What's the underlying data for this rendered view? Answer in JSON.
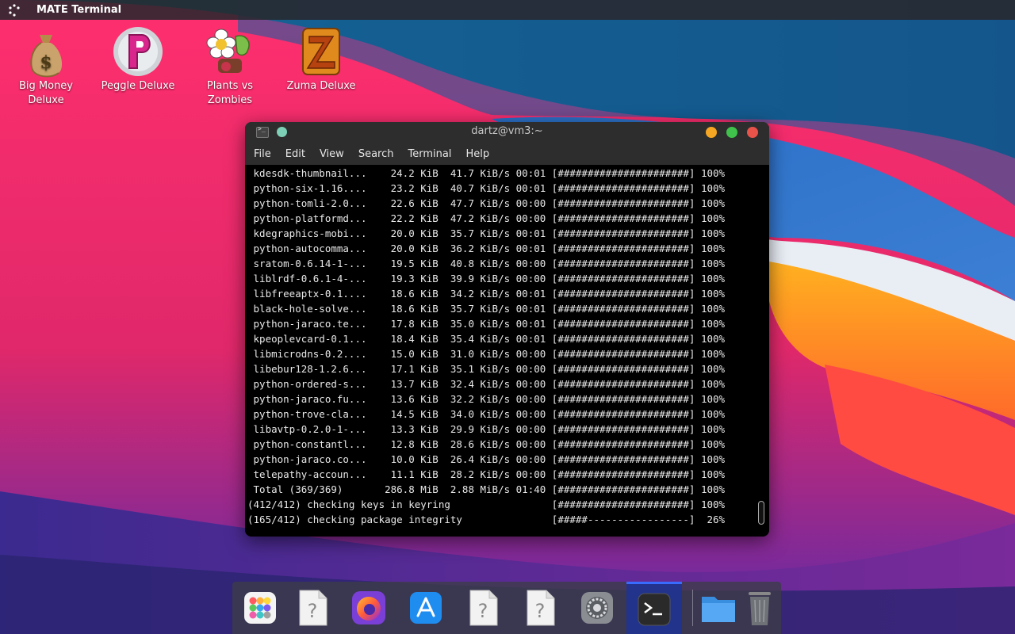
{
  "top_panel": {
    "title": "MATE Terminal",
    "icons": [
      "menu-dots-icon"
    ]
  },
  "desktop_icons": [
    {
      "label": "Big Money Deluxe",
      "icon": "money-bag-icon"
    },
    {
      "label": "Peggle Deluxe",
      "icon": "peggle-icon"
    },
    {
      "label": "Plants vs Zombies",
      "icon": "plants-vs-zombies-icon"
    },
    {
      "label": "Zuma Deluxe",
      "icon": "zuma-icon"
    }
  ],
  "terminal": {
    "title": "dartz@vm3:~",
    "menu": [
      "File",
      "Edit",
      "View",
      "Search",
      "Terminal",
      "Help"
    ],
    "lines": [
      " kdesdk-thumbnail...    24.2 KiB  41.7 KiB/s 00:01 [######################] 100%",
      " python-six-1.16....    23.2 KiB  40.7 KiB/s 00:01 [######################] 100%",
      " python-tomli-2.0...    22.6 KiB  47.7 KiB/s 00:00 [######################] 100%",
      " python-platformd...    22.2 KiB  47.2 KiB/s 00:00 [######################] 100%",
      " kdegraphics-mobi...    20.0 KiB  35.7 KiB/s 00:01 [######################] 100%",
      " python-autocomma...    20.0 KiB  36.2 KiB/s 00:01 [######################] 100%",
      " sratom-0.6.14-1-...    19.5 KiB  40.8 KiB/s 00:00 [######################] 100%",
      " liblrdf-0.6.1-4-...    19.3 KiB  39.9 KiB/s 00:00 [######################] 100%",
      " libfreeaptx-0.1....    18.6 KiB  34.2 KiB/s 00:01 [######################] 100%",
      " black-hole-solve...    18.6 KiB  35.7 KiB/s 00:01 [######################] 100%",
      " python-jaraco.te...    17.8 KiB  35.0 KiB/s 00:01 [######################] 100%",
      " kpeoplevcard-0.1...    18.4 KiB  35.4 KiB/s 00:01 [######################] 100%",
      " libmicrodns-0.2....    15.0 KiB  31.0 KiB/s 00:00 [######################] 100%",
      " libebur128-1.2.6...    17.1 KiB  35.1 KiB/s 00:00 [######################] 100%",
      " python-ordered-s...    13.7 KiB  32.4 KiB/s 00:00 [######################] 100%",
      " python-jaraco.fu...    13.6 KiB  32.2 KiB/s 00:00 [######################] 100%",
      " python-trove-cla...    14.5 KiB  34.0 KiB/s 00:00 [######################] 100%",
      " libavtp-0.2.0-1-...    13.3 KiB  29.9 KiB/s 00:00 [######################] 100%",
      " python-constantl...    12.8 KiB  28.6 KiB/s 00:00 [######################] 100%",
      " python-jaraco.co...    10.0 KiB  26.4 KiB/s 00:00 [######################] 100%",
      " telepathy-accoun...    11.1 KiB  28.2 KiB/s 00:00 [######################] 100%",
      " Total (369/369)       286.8 MiB  2.88 MiB/s 01:40 [######################] 100%",
      "(412/412) checking keys in keyring                 [######################] 100%",
      "(165/412) checking package integrity               [#####-----------------]  26%"
    ]
  },
  "dock": {
    "items": [
      {
        "icon": "app-grid-icon",
        "active": false
      },
      {
        "icon": "unknown-file-icon",
        "active": false
      },
      {
        "icon": "firefox-icon",
        "active": false
      },
      {
        "icon": "app-store-icon",
        "active": false
      },
      {
        "icon": "unknown-file-icon",
        "active": false
      },
      {
        "icon": "unknown-file-icon",
        "active": false
      },
      {
        "icon": "settings-icon",
        "active": false
      },
      {
        "icon": "terminal-icon",
        "active": true
      },
      {
        "icon": "folder-icon",
        "active": false
      },
      {
        "icon": "trash-icon",
        "active": false
      }
    ]
  }
}
